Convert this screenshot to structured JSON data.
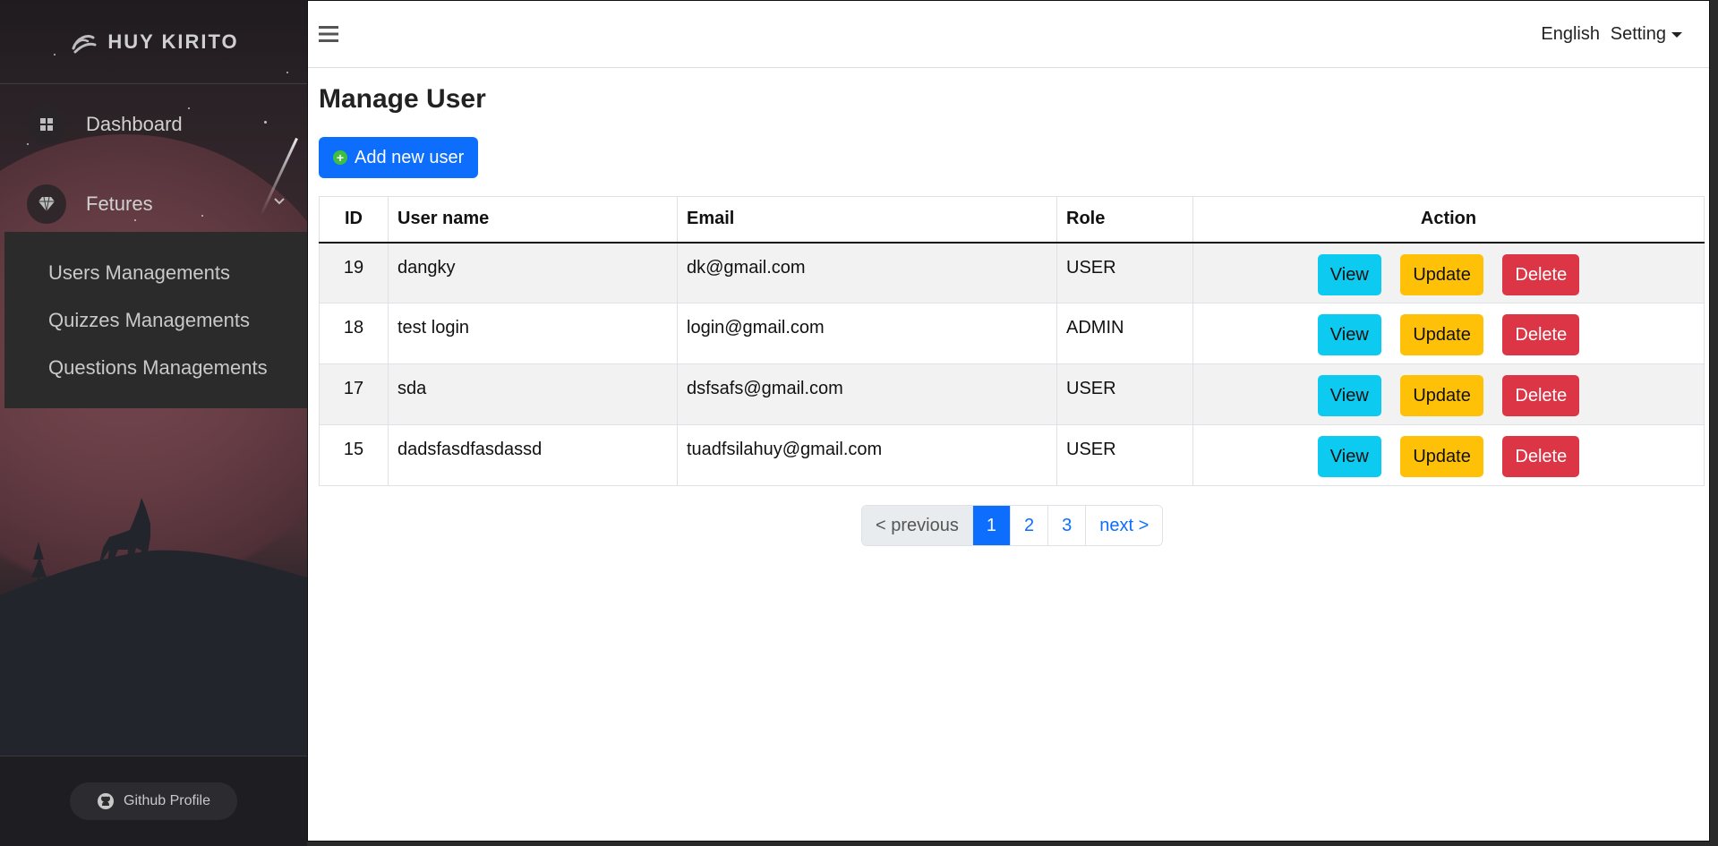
{
  "sidebar": {
    "brand": "HUY KIRITO",
    "menu": {
      "dashboard": "Dashboard",
      "features": "Fetures"
    },
    "submenu": [
      "Users Managements",
      "Quizzes Managements",
      "Questions Managements"
    ],
    "footer_button": "Github Profile"
  },
  "topbar": {
    "language": "English",
    "setting": "Setting"
  },
  "main": {
    "title": "Manage User",
    "add_button": "Add new user",
    "table": {
      "headers": [
        "ID",
        "User name",
        "Email",
        "Role",
        "Action"
      ],
      "rows": [
        {
          "id": "19",
          "username": "dangky",
          "email": "dk@gmail.com",
          "role": "USER"
        },
        {
          "id": "18",
          "username": "test login",
          "email": "login@gmail.com",
          "role": "ADMIN"
        },
        {
          "id": "17",
          "username": "sda",
          "email": "dsfsafs@gmail.com",
          "role": "USER"
        },
        {
          "id": "15",
          "username": "dadsfasdfasdassd",
          "email": "tuadfsilahuy@gmail.com",
          "role": "USER"
        }
      ],
      "actions": {
        "view": "View",
        "update": "Update",
        "delete": "Delete"
      }
    },
    "pagination": {
      "previous": "< previous",
      "pages": [
        "1",
        "2",
        "3"
      ],
      "next": "next >",
      "active_page": "1"
    }
  },
  "colors": {
    "primary": "#0d6efd",
    "info": "#0dcaf0",
    "warning": "#ffc107",
    "danger": "#dc3545"
  }
}
